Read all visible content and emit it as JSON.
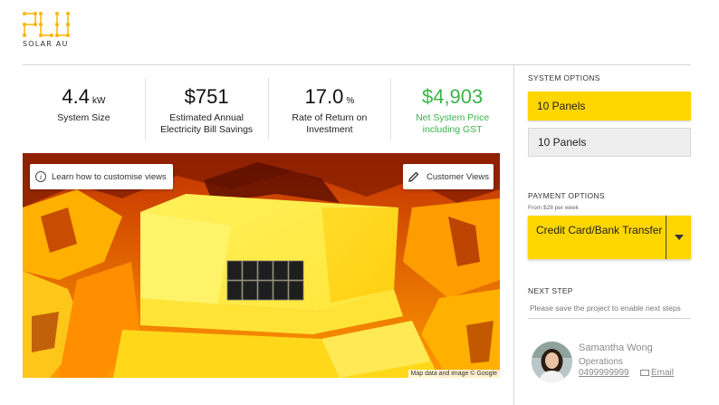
{
  "brand": {
    "logo_text": "SOLAR AU",
    "accent": "#ffd600"
  },
  "stats": [
    {
      "value": "4.4",
      "unit": "kW",
      "label": "System Size",
      "color": "#111111"
    },
    {
      "value": "$751",
      "unit": "",
      "label": "Estimated Annual Electricity Bill Savings",
      "color": "#111111"
    },
    {
      "value": "17.0",
      "unit": "%",
      "label": "Rate of Return on Investment",
      "color": "#111111"
    },
    {
      "value": "$4,903",
      "unit": "",
      "label": "Net System Price including GST",
      "color": "#3cb34a"
    }
  ],
  "map": {
    "learn_label": "Learn how to customise views",
    "views_label": "Customer Views",
    "attribution": "Map data and image © Google",
    "icons": [
      "info-icon",
      "pencil-icon"
    ]
  },
  "sidebar": {
    "system_options_title": "SYSTEM OPTIONS",
    "system_option_selected": "10 Panels",
    "system_option_alt": "10 Panels",
    "payment_title": "PAYMENT OPTIONS",
    "payment_note": "From $28 per week",
    "payment_selected": "Credit Card/Bank Transfer",
    "next_step_title": "NEXT STEP",
    "next_step_note": "Please save the project to enable next steps"
  },
  "contact": {
    "name": "Samantha Wong",
    "role": "Operations",
    "phone": "0499999999",
    "email_label": "Email"
  }
}
